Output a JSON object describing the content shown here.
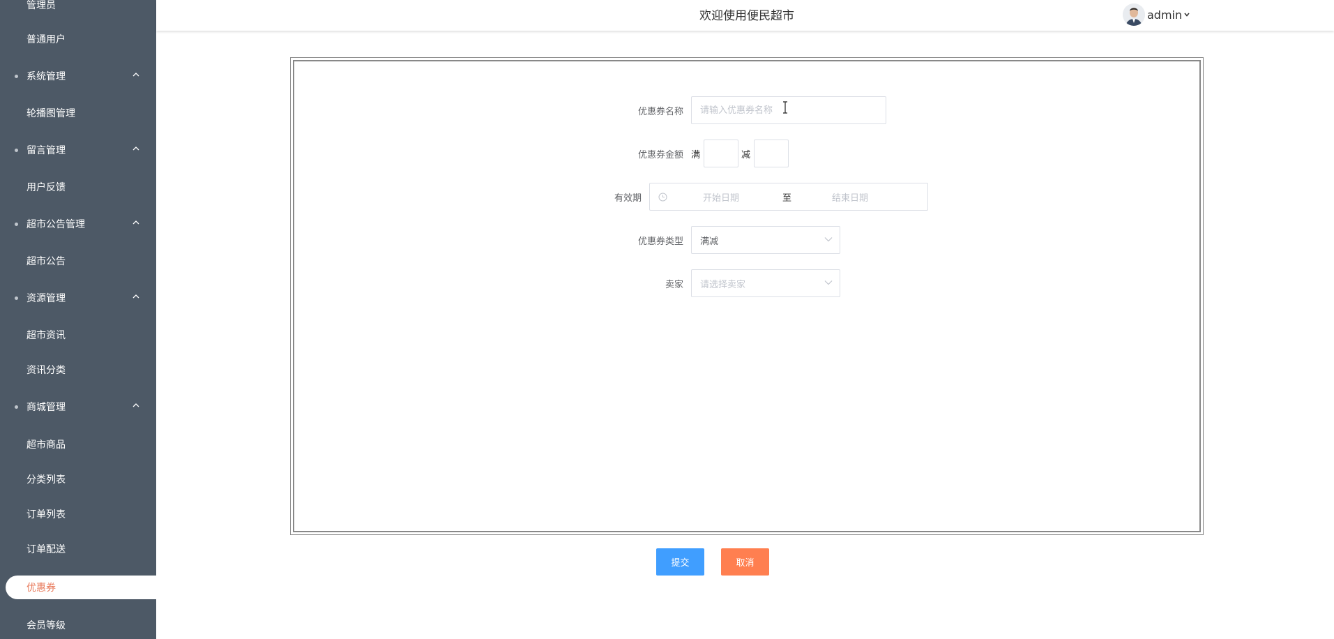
{
  "sidebar": {
    "items": [
      {
        "label": "管理员",
        "type": "sub"
      },
      {
        "label": "普通用户",
        "type": "sub"
      },
      {
        "label": "系统管理",
        "type": "group"
      },
      {
        "label": "轮播图管理",
        "type": "sub"
      },
      {
        "label": "留言管理",
        "type": "group"
      },
      {
        "label": "用户反馈",
        "type": "sub"
      },
      {
        "label": "超市公告管理",
        "type": "group"
      },
      {
        "label": "超市公告",
        "type": "sub"
      },
      {
        "label": "资源管理",
        "type": "group"
      },
      {
        "label": "超市资讯",
        "type": "sub"
      },
      {
        "label": "资讯分类",
        "type": "sub"
      },
      {
        "label": "商城管理",
        "type": "group"
      },
      {
        "label": "超市商品",
        "type": "sub"
      },
      {
        "label": "分类列表",
        "type": "sub"
      },
      {
        "label": "订单列表",
        "type": "sub"
      },
      {
        "label": "订单配送",
        "type": "sub"
      },
      {
        "label": "优惠券",
        "type": "active"
      },
      {
        "label": "会员等级",
        "type": "sub"
      }
    ]
  },
  "header": {
    "title": "欢迎使用便民超市",
    "username": "admin"
  },
  "form": {
    "name_label": "优惠券名称",
    "name_placeholder": "请输入优惠券名称",
    "amount_label": "优惠券金额",
    "full_text": "满",
    "minus_text": "减",
    "full_value": "",
    "minus_value": "",
    "period_label": "有效期",
    "start_placeholder": "开始日期",
    "range_separator": "至",
    "end_placeholder": "结束日期",
    "type_label": "优惠券类型",
    "type_value": "满减",
    "seller_label": "卖家",
    "seller_placeholder": "请选择卖家"
  },
  "buttons": {
    "submit": "提交",
    "cancel": "取消"
  },
  "colors": {
    "sidebar_bg": "#4d5966",
    "active_text": "#e8795a",
    "submit_bg": "#409eff",
    "cancel_bg": "#ff7f50"
  }
}
